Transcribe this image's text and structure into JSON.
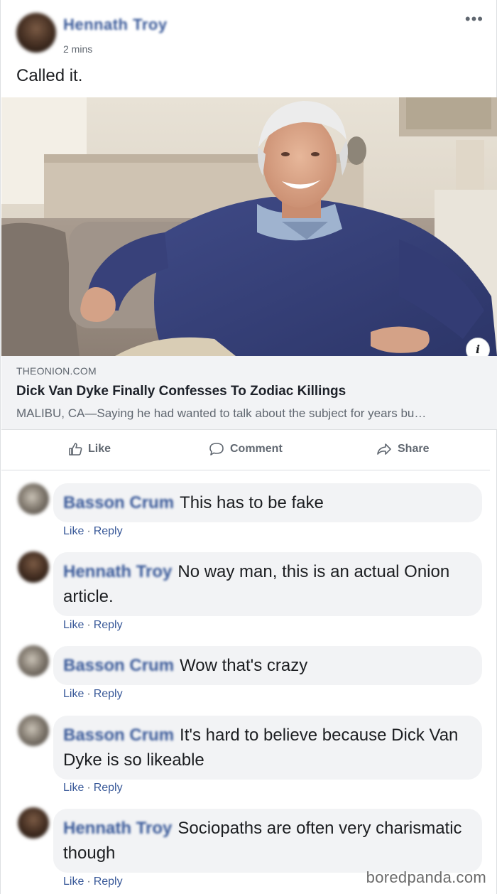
{
  "post": {
    "author": "Hennath Troy",
    "time": "2 mins",
    "text": "Called it.",
    "more_icon": "•••"
  },
  "link": {
    "domain": "THEONION.COM",
    "title": "Dick Van Dyke Finally Confesses To Zodiac Killings",
    "description": "MALIBU, CA—Saying he had wanted to talk about the subject for years bu…",
    "info_icon": "i"
  },
  "actions": {
    "like": "Like",
    "comment": "Comment",
    "share": "Share"
  },
  "comments": [
    {
      "author": "Basson Crum",
      "text": "This has to be fake",
      "like": "Like",
      "reply": "Reply"
    },
    {
      "author": "Hennath Troy",
      "text": "No way man, this is an actual Onion article.",
      "like": "Like",
      "reply": "Reply"
    },
    {
      "author": "Basson Crum",
      "text": "Wow that's crazy",
      "like": "Like",
      "reply": "Reply"
    },
    {
      "author": "Basson Crum",
      "text": "It's hard to believe because Dick Van Dyke is so likeable",
      "like": "Like",
      "reply": "Reply"
    },
    {
      "author": "Hennath Troy",
      "text": "Sociopaths are often very charismatic though",
      "like": "Like",
      "reply": "Reply"
    }
  ],
  "watermark": "boredpanda.com",
  "colors": {
    "link_blue": "#385898",
    "muted_grey": "#606770",
    "bubble_bg": "#f2f3f5"
  }
}
